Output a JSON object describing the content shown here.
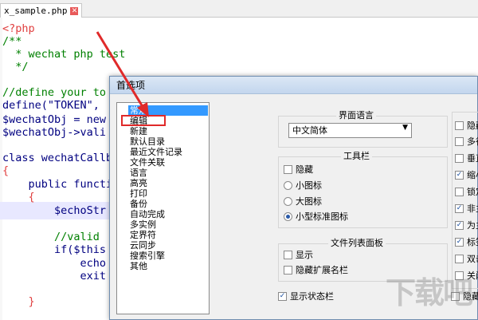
{
  "editor": {
    "tab_label": "x_sample.php",
    "tab_close_icon": "close-icon",
    "lines": [
      "<?php",
      "/**",
      "  * wechat php test",
      "  */",
      "",
      "//define your to",
      "define(\"TOKEN\", ",
      "$wechatObj = new",
      "$wechatObj->vali",
      "",
      "class wechatCallb",
      "{",
      "    public functi",
      "    {",
      "        $echoStr",
      "",
      "        //valid",
      "        if($this",
      "            echo",
      "            exit",
      "    }"
    ]
  },
  "dialog": {
    "title": "首选项",
    "categories": [
      "常规",
      "编辑",
      "新建",
      "默认目录",
      "最近文件记录",
      "文件关联",
      "语言",
      "高亮",
      "打印",
      "备份",
      "自动完成",
      "多实例",
      "定界符",
      "云同步",
      "搜索引擎",
      "其他"
    ],
    "selected_category": 0,
    "ui_language": {
      "title": "界面语言",
      "value": "中文简体"
    },
    "toolbar": {
      "title": "工具栏",
      "hide": "隐藏",
      "small_icon": "小图标",
      "large_icon": "大图标",
      "small_standard_icon": "小型标准图标",
      "selected": "small_standard_icon"
    },
    "doc_list_panel": {
      "title": "文件列表面板",
      "show": "显示",
      "hide_ext": "隐藏扩展名栏"
    },
    "status_bar": {
      "label": "显示状态栏",
      "checked": true
    },
    "right_column": [
      {
        "label": "隐藏",
        "checked": false
      },
      {
        "label": "多行",
        "checked": false
      },
      {
        "label": "垂直",
        "checked": false
      },
      {
        "label": "缩小",
        "checked": true
      },
      {
        "label": "锁定",
        "checked": false
      },
      {
        "label": "非主",
        "checked": true
      },
      {
        "label": "为主",
        "checked": true
      },
      {
        "label": "标签",
        "checked": true
      },
      {
        "label": "双击",
        "checked": false
      },
      {
        "label": "关闭",
        "checked": false
      }
    ],
    "bottom_right": {
      "label": "隐藏",
      "checked": false
    }
  },
  "annotation": {
    "highlight_color": "#e02a2a"
  },
  "watermark": "下载吧"
}
